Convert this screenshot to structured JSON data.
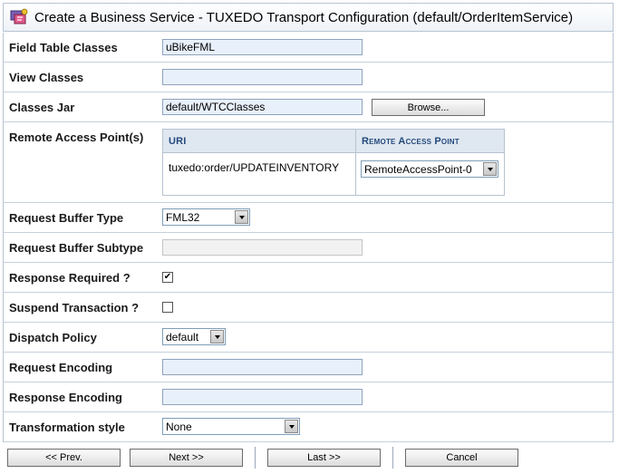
{
  "header": {
    "title": "Create a Business Service - TUXEDO Transport Configuration (default/OrderItemService)",
    "icon": "business-service-icon"
  },
  "fields": {
    "field_table_classes": {
      "label": "Field Table Classes",
      "value": "uBikeFML"
    },
    "view_classes": {
      "label": "View Classes",
      "value": ""
    },
    "classes_jar": {
      "label": "Classes Jar",
      "value": "default/WTCClasses",
      "browse_label": "Browse..."
    },
    "remote_access_points": {
      "label": "Remote Access Point(s)",
      "columns": [
        "URI",
        "Remote Access Point"
      ],
      "rows": [
        {
          "uri": "tuxedo:order/UPDATEINVENTORY",
          "access_point": "RemoteAccessPoint-0"
        }
      ]
    },
    "request_buffer_type": {
      "label": "Request Buffer Type",
      "value": "FML32"
    },
    "request_buffer_subtype": {
      "label": "Request Buffer Subtype",
      "value": ""
    },
    "response_required": {
      "label": "Response Required ?",
      "checked": true,
      "mark": "✔"
    },
    "suspend_transaction": {
      "label": "Suspend Transaction ?",
      "checked": false,
      "mark": ""
    },
    "dispatch_policy": {
      "label": "Dispatch Policy",
      "value": "default"
    },
    "request_encoding": {
      "label": "Request Encoding",
      "value": ""
    },
    "response_encoding": {
      "label": "Response Encoding",
      "value": ""
    },
    "transformation_style": {
      "label": "Transformation style",
      "value": "None"
    }
  },
  "nav": {
    "prev_label": "<< Prev.",
    "next_label": "Next >>",
    "last_label": "Last >>",
    "cancel_label": "Cancel"
  },
  "colors": {
    "input_bg": "#e8f0fb",
    "header_bg": "#dfe7f1",
    "header_text": "#244a7c",
    "border": "#b7c3d1"
  }
}
